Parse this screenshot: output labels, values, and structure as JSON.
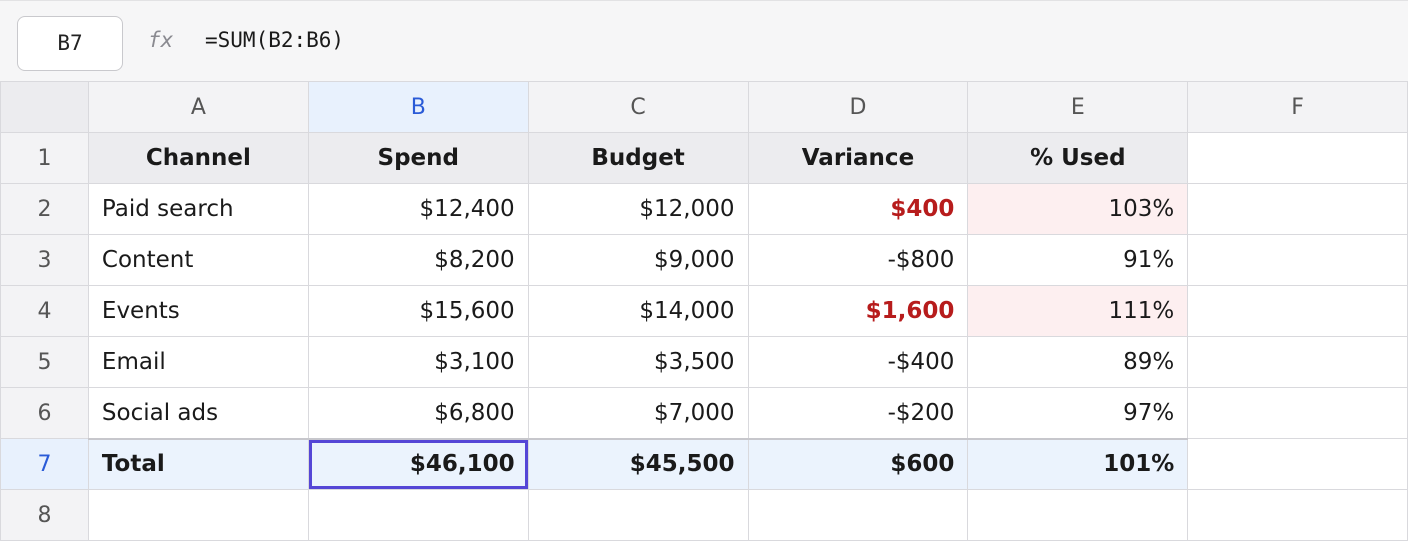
{
  "formula_bar": {
    "name_box": "B7",
    "fx_label": "fx",
    "formula": "=SUM(B2:B6)"
  },
  "columns": [
    "A",
    "B",
    "C",
    "D",
    "E",
    "F"
  ],
  "rows": [
    "1",
    "2",
    "3",
    "4",
    "5",
    "6",
    "7",
    "8"
  ],
  "header_row": [
    "Channel",
    "Spend",
    "Budget",
    "Variance",
    "% Used"
  ],
  "data_rows": [
    {
      "channel": "Paid search",
      "spend": "$12,400",
      "budget": "$12,000",
      "variance": "$400",
      "used": "103%"
    },
    {
      "channel": "Content",
      "spend": "$8,200",
      "budget": "$9,000",
      "variance": "-$800",
      "used": "91%"
    },
    {
      "channel": "Events",
      "spend": "$15,600",
      "budget": "$14,000",
      "variance": "$1,600",
      "used": "111%"
    },
    {
      "channel": "Email",
      "spend": "$3,100",
      "budget": "$3,500",
      "variance": "-$400",
      "used": "89%"
    },
    {
      "channel": "Social ads",
      "spend": "$6,800",
      "budget": "$7,000",
      "variance": "-$200",
      "used": "97%"
    }
  ],
  "total_row": {
    "channel": "Total",
    "spend": "$46,100",
    "budget": "$45,500",
    "variance": "$600",
    "used": "101%"
  },
  "colors": {
    "selection": "#5546d6",
    "over_budget_text": "#b71c1c",
    "over_budget_fill": "#fdeff0",
    "active_header": "#2a5bd7",
    "total_fill": "#ebf3fd"
  }
}
